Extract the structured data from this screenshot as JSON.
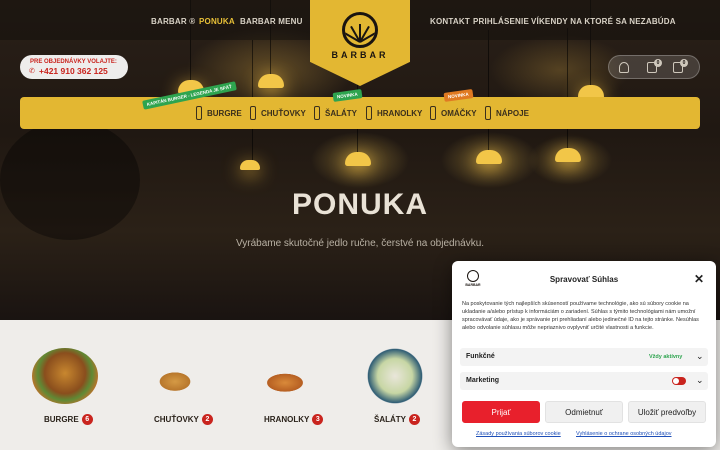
{
  "nav": {
    "left": [
      "BARBAR ®",
      "PONUKA",
      "BARBAR MENU"
    ],
    "right": [
      "KONTAKT",
      "PRIHLÁSENIE",
      "VÍKENDY NA KTORÉ SA NEZABÚDA"
    ],
    "active": "PONUKA"
  },
  "logo": {
    "text": "BARBAR"
  },
  "phone": {
    "label": "PRE OBJEDNÁVKY VOLAJTE:",
    "number": "+421 910 362 125"
  },
  "header_icons": [
    {
      "icon": "user-icon"
    },
    {
      "icon": "heart-icon",
      "badge": "0"
    },
    {
      "icon": "cart-icon",
      "badge": "0"
    }
  ],
  "categories": [
    {
      "label": "BURGRE",
      "icon": "burger-icon"
    },
    {
      "label": "CHUŤOVKY",
      "icon": "snack-icon"
    },
    {
      "label": "ŠALÁTY",
      "icon": "salad-icon"
    },
    {
      "label": "HRANOLKY",
      "icon": "fries-icon"
    },
    {
      "label": "OMÁČKY",
      "icon": "sauce-icon"
    },
    {
      "label": "NÁPOJE",
      "icon": "drink-icon"
    }
  ],
  "tags": {
    "burger_promo": "KAPITÁN BURGER - LEGENDA JE SPÄŤ",
    "salad_tag": "NOVINKA",
    "sauce_tag": "NOVINKA"
  },
  "hero": {
    "title": "PONUKA",
    "subtitle": "Vyrábame skutočné jedlo ručne, čerstvé na objednávku."
  },
  "products": [
    {
      "label": "BURGRE",
      "count": "6"
    },
    {
      "label": "CHUŤOVKY",
      "count": "2"
    },
    {
      "label": "HRANOLKY",
      "count": "3"
    },
    {
      "label": "ŠALÁTY",
      "count": "2"
    }
  ],
  "cookie": {
    "title": "Spravovať Súhlas",
    "text": "Na poskytovanie tých najlepších skúseností používame technológie, ako sú súbory cookie na ukladanie a/alebo prístup k informáciám o zariadení. Súhlas s týmito technológiami nám umožní spracovávať údaje, ako je správanie pri prehliadaní alebo jedinečné ID na tejto stránke. Nesúhlas alebo odvolanie súhlasu môže nepriaznivo ovplyvniť určité vlastnosti a funkcie.",
    "functional_label": "Funkčné",
    "functional_status": "Vždy aktívny",
    "marketing_label": "Marketing",
    "accept": "Prijať",
    "deny": "Odmietnuť",
    "preferences": "Uložiť predvoľby",
    "cookie_policy": "Zásady používania súborov cookie",
    "privacy_policy": "Vyhlásenie o ochrane osobných údajov"
  },
  "colors": {
    "accent_yellow": "#e3b732",
    "red": "#c9241e",
    "accept_red": "#e8202c"
  }
}
